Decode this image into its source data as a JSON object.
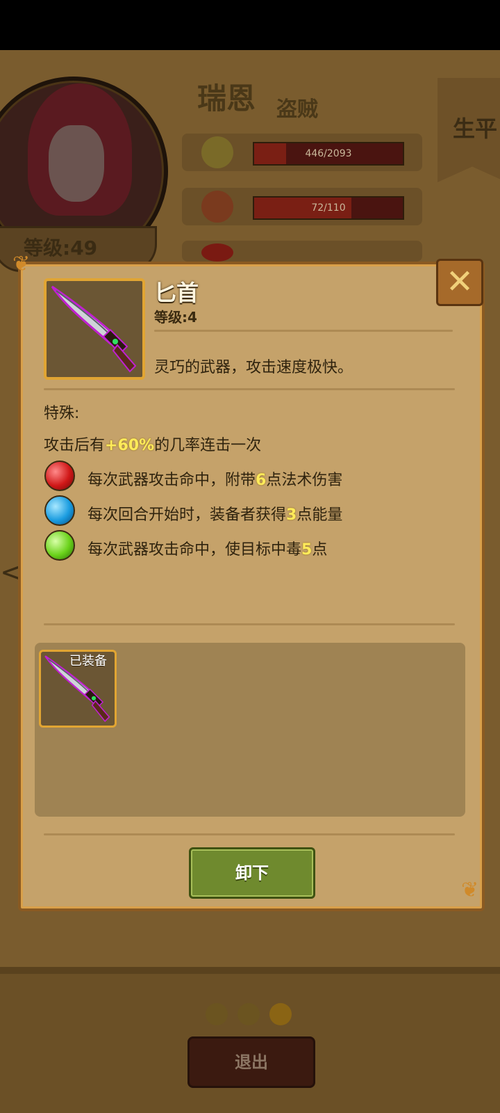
{
  "hero": {
    "name": "瑞恩",
    "class": "盗贼",
    "level_label": "等级:49",
    "stats": [
      {
        "icon": "medal-icon",
        "text": "446/2093",
        "fill": 0.213
      },
      {
        "icon": "stomach-icon",
        "text": "72/110",
        "fill": 0.655
      },
      {
        "icon": "heart-icon",
        "text": "",
        "fill": 0
      }
    ],
    "side_tab": "生平"
  },
  "modal": {
    "item_icon": "dagger-icon",
    "title": "匕首",
    "level": "等级:4",
    "description": "灵巧的武器，攻击速度极快。",
    "special_label": "特殊:",
    "special_prefix": "攻击后有",
    "special_value": "+60%",
    "special_suffix": "的几率连击一次",
    "gems": [
      {
        "color": "#d01818",
        "icon": "red-gem-icon",
        "prefix": "每次武器攻击命中，附带",
        "value": "6",
        "suffix": "点法术伤害"
      },
      {
        "color": "#1a9ce0",
        "icon": "blue-gem-icon",
        "prefix": "每次回合开始时，装备者获得",
        "value": "3",
        "suffix": "点能量"
      },
      {
        "color": "#6ad21a",
        "icon": "green-gem-icon",
        "prefix": "每次武器攻击命中，使目标中毒",
        "value": "5",
        "suffix": "点"
      }
    ],
    "slot_label": "已装备",
    "unequip_label": "卸下"
  },
  "page_dots": 3,
  "exit_label": "退出",
  "colors": {
    "panel": "#c5a26a",
    "highlight": "#ffeb5a",
    "button_green": "#6f8a2e"
  }
}
